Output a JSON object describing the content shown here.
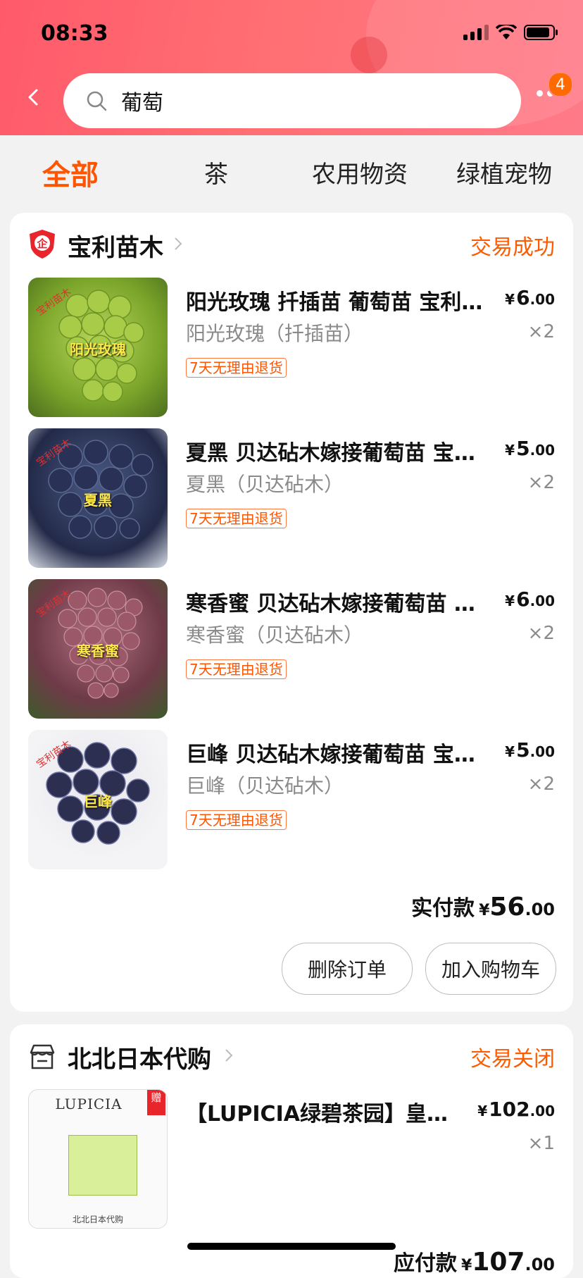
{
  "status_bar": {
    "time": "08:33"
  },
  "search": {
    "query": "葡萄",
    "badge_count": "4"
  },
  "tabs": [
    {
      "label": "全部",
      "active": true
    },
    {
      "label": "茶"
    },
    {
      "label": "农用物资"
    },
    {
      "label": "绿植宠物"
    }
  ],
  "orders": [
    {
      "shop_name": "宝利苗木",
      "status": "交易成功",
      "items": [
        {
          "title": "阳光玫瑰 扦插苗 葡萄苗  宝利苗木",
          "sku": "阳光玫瑰（扦插苗）",
          "tag": "7天无理由退货",
          "price_currency": "¥",
          "price_int": "6",
          "price_dec": ".00",
          "qty": "×2",
          "thumb_label": "阳光玫瑰",
          "thumb_stamp": "宝利苗木",
          "thumb_color": "#9cc43a"
        },
        {
          "title": "夏黑 贝达砧木嫁接葡萄苗  宝利苗木",
          "sku": "夏黑（贝达砧木）",
          "tag": "7天无理由退货",
          "price_currency": "¥",
          "price_int": "5",
          "price_dec": ".00",
          "qty": "×2",
          "thumb_label": "夏黑",
          "thumb_stamp": "宝利苗木",
          "thumb_color": "#2c3558"
        },
        {
          "title": "寒香蜜 贝达砧木嫁接葡萄苗  宝利苗木",
          "sku": "寒香蜜（贝达砧木）",
          "tag": "7天无理由退货",
          "price_currency": "¥",
          "price_int": "6",
          "price_dec": ".00",
          "qty": "×2",
          "thumb_label": "寒香蜜",
          "thumb_stamp": "宝利苗木",
          "thumb_color": "#8a4a5c"
        },
        {
          "title": "巨峰   贝达砧木嫁接葡萄苗  宝利苗木",
          "sku": "巨峰（贝达砧木）",
          "tag": "7天无理由退货",
          "price_currency": "¥",
          "price_int": "5",
          "price_dec": ".00",
          "qty": "×2",
          "thumb_label": "巨峰",
          "thumb_stamp": "宝利苗木",
          "thumb_color": "#2e3050"
        }
      ],
      "total_label": "实付款",
      "total_currency": "¥",
      "total_int": "56",
      "total_dec": ".00",
      "buttons": [
        "删除订单",
        "加入购物车"
      ]
    },
    {
      "shop_name": "北北日本代购",
      "status": "交易关闭",
      "items": [
        {
          "title": "【LUPICIA绿碧茶园】皇后麝香葡萄乌龙茶",
          "sku": "",
          "price_currency": "¥",
          "price_int": "102",
          "price_dec": ".00",
          "qty": "×1",
          "thumb_brand": "LUPICIA",
          "thumb_gift": "赠",
          "thumb_caption": "北北日本代购"
        }
      ],
      "total_label": "应付款",
      "total_currency": "¥",
      "total_int": "107",
      "total_dec": ".00"
    }
  ],
  "colors": {
    "accent": "#ff5500",
    "header": "#ff6a78"
  }
}
